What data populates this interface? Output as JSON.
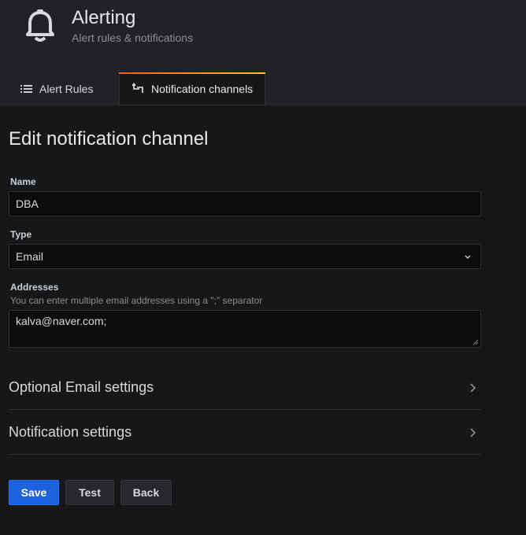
{
  "header": {
    "title": "Alerting",
    "subtitle": "Alert rules & notifications",
    "icon": "bell-icon"
  },
  "tabs": [
    {
      "label": "Alert Rules",
      "icon": "list-icon",
      "active": false
    },
    {
      "label": "Notification channels",
      "icon": "channel-icon",
      "active": true
    }
  ],
  "page_title": "Edit notification channel",
  "form": {
    "name": {
      "label": "Name",
      "value": "DBA"
    },
    "type": {
      "label": "Type",
      "value": "Email"
    },
    "addresses": {
      "label": "Addresses",
      "description": "You can enter multiple email addresses using a \";\" separator",
      "value": "kalva@naver.com;"
    }
  },
  "sections": [
    {
      "label": "Optional Email settings"
    },
    {
      "label": "Notification settings"
    }
  ],
  "buttons": {
    "save": "Save",
    "test": "Test",
    "back": "Back"
  },
  "colors": {
    "primary": "#1f62e0",
    "tab_accent_start": "#f05a28",
    "tab_accent_end": "#fbca0a",
    "background": "#161719"
  }
}
